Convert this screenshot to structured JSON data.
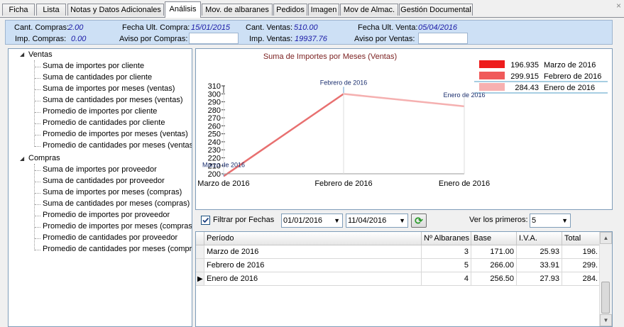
{
  "tabs": [
    "Ficha",
    "Lista",
    "Notas y Datos Adicionales",
    "Análisis",
    "Mov. de albaranes",
    "Pedidos",
    "Imagen",
    "Mov de Almac.",
    "Gestión Documental"
  ],
  "active_tab": "Análisis",
  "close_glyph": "×",
  "header": {
    "cant_compras_label": "Cant. Compras:",
    "cant_compras": "2.00",
    "imp_compras_label": "Imp. Compras:",
    "imp_compras": "0.00",
    "fecha_ult_compra_label": "Fecha Ult. Compra:",
    "fecha_ult_compra": "15/01/2015",
    "aviso_compras_label": "Aviso por Compras:",
    "cant_ventas_label": "Cant. Ventas:",
    "cant_ventas": "510.00",
    "imp_ventas_label": "Imp. Ventas:",
    "imp_ventas": "19937.76",
    "fecha_ult_venta_label": "Fecha Ult. Venta:",
    "fecha_ult_venta": "05/04/2016",
    "aviso_ventas_label": "Aviso por Ventas:"
  },
  "tree": {
    "ventas_label": "Ventas",
    "ventas_items": [
      "Suma de importes por cliente",
      "Suma de cantidades por cliente",
      "Suma de importes por meses (ventas)",
      "Suma de cantidades por meses (ventas)",
      "Promedio de importes por cliente",
      "Promedio de cantidades por cliente",
      "Promedio de importes por meses (ventas)",
      "Promedio de cantidades por meses (ventas"
    ],
    "compras_label": "Compras",
    "compras_items": [
      "Suma de importes por proveedor",
      "Suma de cantidades por proveedor",
      "Suma de importes por meses (compras)",
      "Suma de cantidades por meses (compras)",
      "Promedio de importes por proveedor",
      "Promedio de importes por meses (compras)",
      "Promedio de cantidades por proveedor",
      "Promedio de cantidades por meses (compra"
    ]
  },
  "chart_data": {
    "type": "line",
    "title": "Suma de Importes por Meses (Ventas)",
    "categories": [
      "Marzo de 2016",
      "Febrero de 2016",
      "Enero de 2016"
    ],
    "values": [
      196.935,
      299.915,
      284.43
    ],
    "point_labels": [
      "Marzo de 2016",
      "Febrero de 2016",
      "Enero de 2016"
    ],
    "yticks": [
      200,
      210,
      220,
      230,
      240,
      250,
      260,
      270,
      280,
      290,
      300,
      310
    ],
    "ylim": [
      200,
      310
    ],
    "segment_colors": [
      "#e87070",
      "#f5b0b0"
    ],
    "legend": [
      {
        "value": "196.935",
        "name": "Marzo de 2016",
        "color": "#ee1c1c"
      },
      {
        "value": "299.915",
        "name": "Febrero de 2016",
        "color": "#f05a5a"
      },
      {
        "value": "284.43",
        "name": "Enero de 2016",
        "color": "#f7b0b0"
      }
    ],
    "legend_position": "top-right"
  },
  "filter": {
    "checkbox_label": "Filtrar por Fechas",
    "checked": true,
    "date_from": "01/01/2016",
    "date_to": "11/04/2016",
    "ver_label": "Ver los primeros:",
    "ver_value": "5"
  },
  "table": {
    "columns": [
      "Período",
      "Nº Albaranes",
      "Base",
      "I.V.A.",
      "Total"
    ],
    "rows": [
      {
        "periodo": "Marzo de 2016",
        "albaranes": "3",
        "base": "171.00",
        "iva": "25.93",
        "total": "196."
      },
      {
        "periodo": "Febrero de 2016",
        "albaranes": "5",
        "base": "266.00",
        "iva": "33.91",
        "total": "299."
      },
      {
        "periodo": "Enero de 2016",
        "albaranes": "4",
        "base": "256.50",
        "iva": "27.93",
        "total": "284."
      }
    ],
    "current_row": 2
  }
}
